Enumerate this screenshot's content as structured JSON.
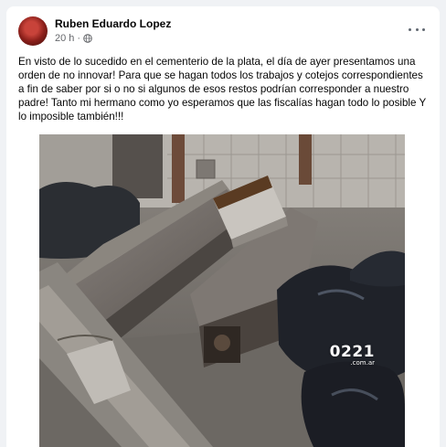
{
  "post": {
    "author": "Ruben Eduardo Lopez",
    "time": "20 h",
    "separator": "·",
    "privacy_icon": "globe-icon",
    "menu_icon": "more-options-icon",
    "body": "En visto de lo sucedido en el cementerio de la plata, el día de ayer presentamos una orden de no innovar! Para que se hagan todos los trabajos y cotejos correspondientes a fin de saber por si o no si algunos de esos restos podrían corresponder a nuestro padre! Tanto mi hermano como yo esperamos que las fiscalías hagan todo lo posible Y lo imposible también!!!"
  },
  "photo": {
    "watermark": "0221",
    "watermark_sub": ".com.ar"
  }
}
